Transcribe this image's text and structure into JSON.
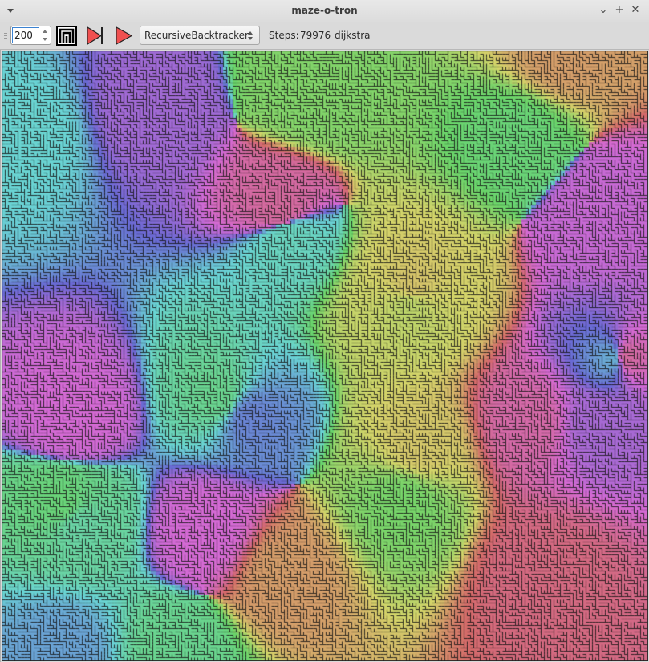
{
  "window": {
    "title": "maze-o-tron",
    "minimize_glyph": "⌄",
    "maximize_glyph": "+",
    "close_glyph": "✕"
  },
  "toolbar": {
    "size_value": "200",
    "algorithm_selected": "RecursiveBacktracker",
    "steps_label": "Steps:",
    "steps_value": "79976",
    "solver_label": "dijkstra",
    "icons": [
      "new-maze-icon",
      "step-to-end-icon",
      "play-icon"
    ]
  },
  "colors": {
    "step_play_red": "#f05050",
    "maze_palette": [
      "#d4d46a",
      "#6fd4a0",
      "#6ad0d0",
      "#7b7bd4",
      "#c96ad4",
      "#d46a6a",
      "#d4b46a",
      "#7bd46a"
    ]
  }
}
